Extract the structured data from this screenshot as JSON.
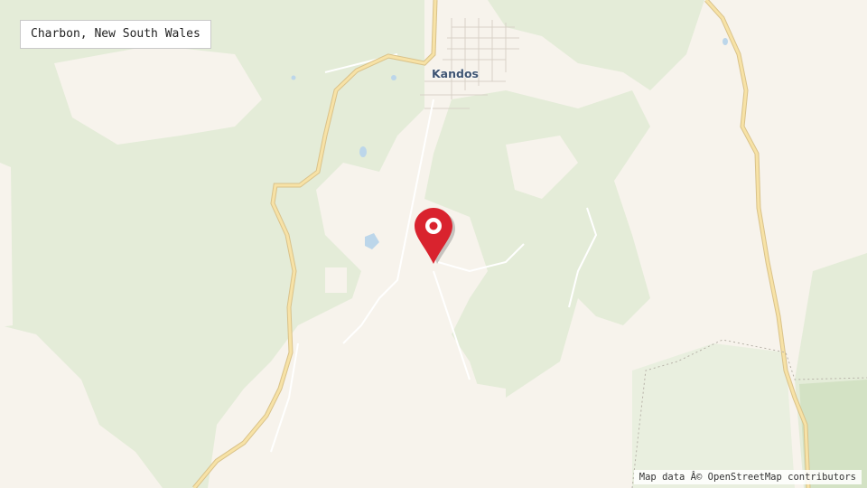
{
  "location_label": "Charbon, New South Wales",
  "town_name": "Kandos",
  "attribution": "Map data Â© OpenStreetMap contributors",
  "colors": {
    "land": "#f7f3ec",
    "forest": "#e4ecd8",
    "forest_dark": "#d3e2c4",
    "road": "#f4d98a",
    "minor_road": "#ffffff",
    "town_text": "#3e5472",
    "marker": "#d9232e"
  },
  "icons": {
    "marker": "map-pin-icon"
  }
}
